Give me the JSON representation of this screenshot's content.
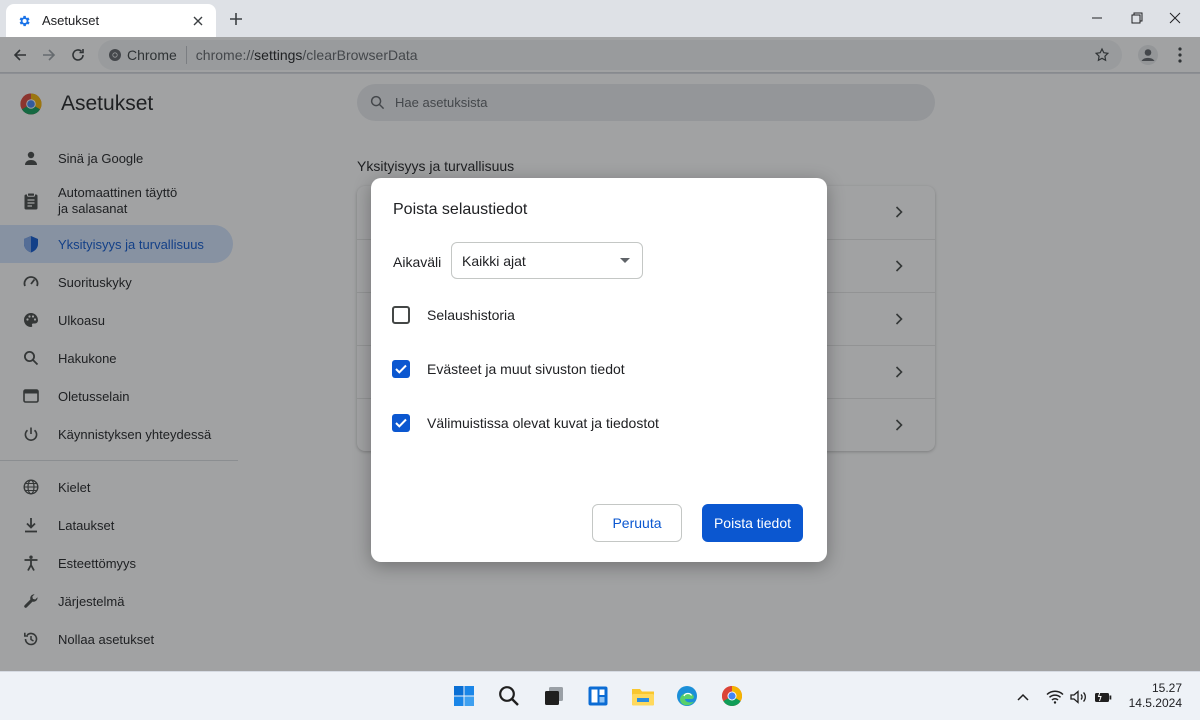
{
  "window": {
    "tab_title": "Asetukset",
    "new_tab_symbol": "+"
  },
  "toolbar": {
    "chip_label": "Chrome",
    "url_prefix": "chrome://",
    "url_host": "settings",
    "url_path": "/clearBrowserData"
  },
  "settings": {
    "title": "Asetukset",
    "search_placeholder": "Hae asetuksista",
    "section_title": "Yksityisyys ja turvallisuus",
    "nav_group1": [
      {
        "label": "Sinä ja Google",
        "icon": "person-icon"
      },
      {
        "label": "Automaattinen täyttö\nja salasanat",
        "icon": "clipboard-icon"
      },
      {
        "label": "Yksityisyys ja turvallisuus",
        "icon": "shield-icon",
        "active": true
      },
      {
        "label": "Suorituskyky",
        "icon": "speedometer-icon"
      },
      {
        "label": "Ulkoasu",
        "icon": "palette-icon"
      },
      {
        "label": "Hakukone",
        "icon": "search-icon"
      },
      {
        "label": "Oletusselain",
        "icon": "browser-window-icon"
      },
      {
        "label": "Käynnistyksen yhteydessä",
        "icon": "power-icon"
      }
    ],
    "nav_group2": [
      {
        "label": "Kielet",
        "icon": "globe-icon"
      },
      {
        "label": "Lataukset",
        "icon": "download-icon"
      },
      {
        "label": "Esteettömyys",
        "icon": "accessibility-icon"
      },
      {
        "label": "Järjestelmä",
        "icon": "wrench-icon"
      },
      {
        "label": "Nollaa asetukset",
        "icon": "reset-icon"
      }
    ]
  },
  "dialog": {
    "title": "Poista selaustiedot",
    "range_label": "Aikaväli",
    "range_value": "Kaikki ajat",
    "options": [
      {
        "label": "Selaushistoria",
        "checked": false
      },
      {
        "label": "Evästeet ja muut sivuston tiedot",
        "checked": true
      },
      {
        "label": "Välimuistissa olevat kuvat ja tiedostot",
        "checked": true
      }
    ],
    "cancel_label": "Peruuta",
    "confirm_label": "Poista tiedot"
  },
  "taskbar": {
    "time": "15.27",
    "date": "14.5.2024"
  },
  "colors": {
    "accent": "#0b57d0",
    "active_nav_bg": "#d3e3fd"
  }
}
